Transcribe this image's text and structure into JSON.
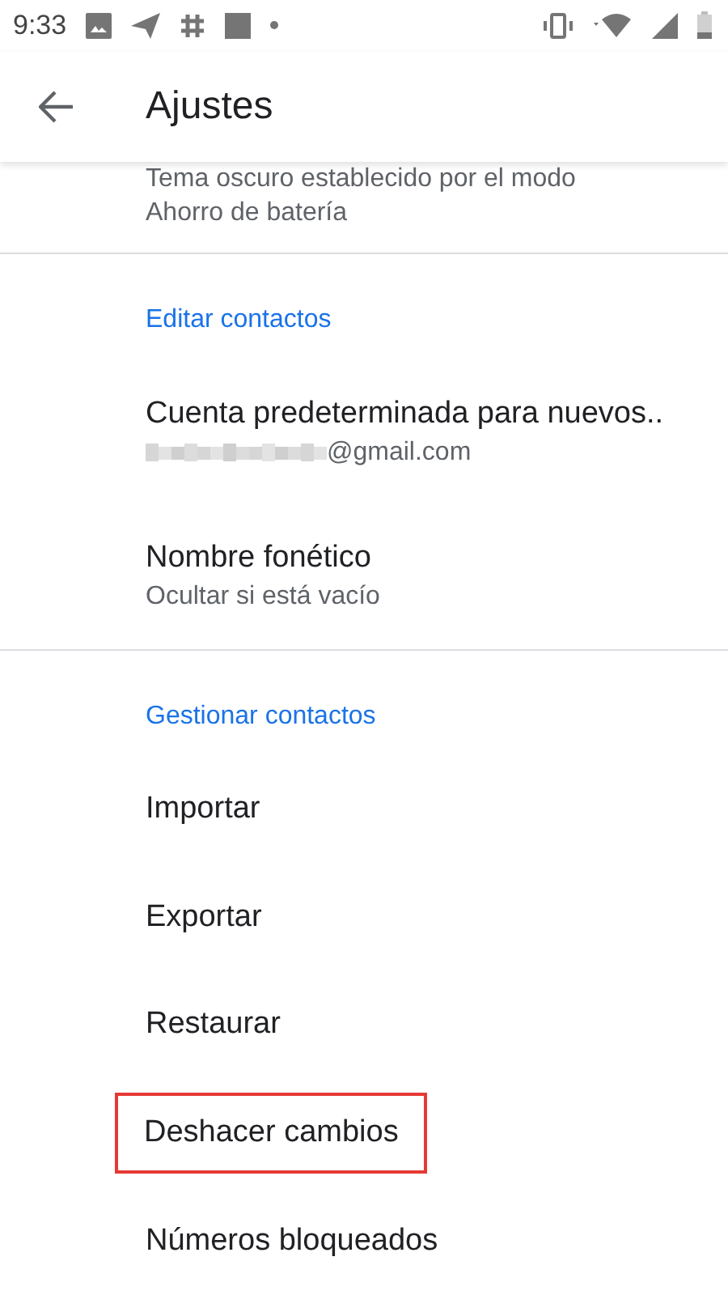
{
  "status_bar": {
    "time": "9:33"
  },
  "app_bar": {
    "title": "Ajustes"
  },
  "top_item": {
    "subtitle_lines": [
      "Tema oscuro establecido por el modo",
      "Ahorro de batería"
    ]
  },
  "sections": [
    {
      "title": "Editar contactos",
      "items": [
        {
          "title": "Cuenta predeterminada para nuevos..",
          "subtitle": "@gmail.com",
          "redacted": true,
          "highlighted": false
        },
        {
          "title": "Nombre fonético",
          "subtitle": "Ocultar si está vacío",
          "highlighted": false
        }
      ]
    },
    {
      "title": "Gestionar contactos",
      "items": [
        {
          "title": "Importar",
          "highlighted": false
        },
        {
          "title": "Exportar",
          "highlighted": false
        },
        {
          "title": "Restaurar",
          "highlighted": false
        },
        {
          "title": "Deshacer cambios",
          "highlighted": true
        },
        {
          "title": "Números bloqueados",
          "highlighted": false
        }
      ]
    }
  ]
}
